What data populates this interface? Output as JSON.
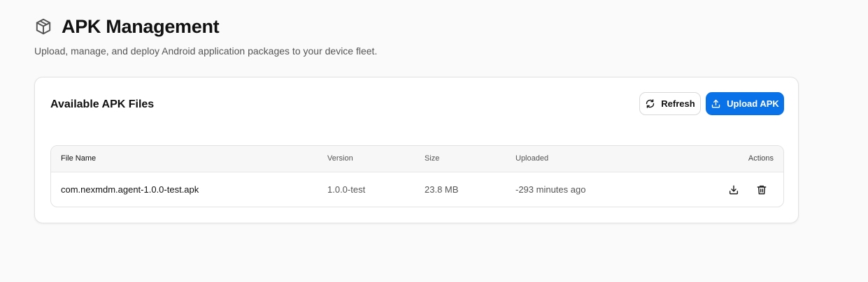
{
  "header": {
    "title": "APK Management",
    "subtitle": "Upload, manage, and deploy Android application packages to your device fleet.",
    "icon": "package-icon"
  },
  "card": {
    "title": "Available APK Files",
    "refresh_label": "Refresh",
    "upload_label": "Upload APK"
  },
  "table": {
    "columns": [
      "File Name",
      "Version",
      "Size",
      "Uploaded",
      "Actions"
    ],
    "rows": [
      {
        "file_name": "com.nexmdm.agent-1.0.0-test.apk",
        "version": "1.0.0-test",
        "size": "23.8 MB",
        "uploaded": "-293 minutes ago",
        "actions": [
          "download-icon",
          "trash-icon"
        ]
      }
    ]
  },
  "colors": {
    "accent": "#0a72e8",
    "background": "#fafafa",
    "card": "#ffffff"
  }
}
